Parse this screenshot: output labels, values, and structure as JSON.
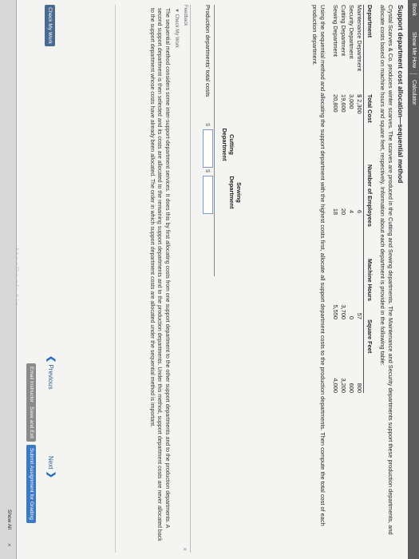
{
  "toolbar": {
    "book": "Book",
    "show_me_how": "Show Me How",
    "calculator": "Calculator"
  },
  "problem": {
    "title": "Support department cost allocation—sequential method",
    "intro": "Crystal Scarves & Co. produces winter scarves. The scarves are produced in the Cutting and Sewing departments. The Maintenance and Security departments support these production departments, and allocate costs based on machine hours and square feet, respectively. Information about each department is provided in the following table:",
    "instruction": "Using the sequential method and allocating the support department with the highest costs first, allocate all support department costs to the production departments. Then compute the total cost of each production department."
  },
  "table": {
    "headers": [
      "Department",
      "Total Cost",
      "Number of Employees",
      "Machine Hours",
      "Square Feet"
    ],
    "rows": [
      [
        "Maintenance Department",
        "$ 2,300",
        "6",
        "57",
        "800"
      ],
      [
        "Security Department",
        "3,000",
        "4",
        "0",
        "600"
      ],
      [
        "Cutting Department",
        "19,600",
        "20",
        "3,700",
        "3,200"
      ],
      [
        "Sewing Department",
        "20,800",
        "18",
        "5,550",
        "4,000"
      ]
    ]
  },
  "answer": {
    "cutting_header_1": "Cutting",
    "cutting_header_2": "Department",
    "sewing_header_1": "Sewing",
    "sewing_header_2": "Department",
    "row_label": "Production departments' total costs",
    "currency": "$",
    "cutting_value": "",
    "sewing_value": ""
  },
  "feedback": {
    "label": "Feedback",
    "check_my_work": "▼ Check My Work",
    "text": "The sequential method considers some inter-support-department services. It does this by first allocating costs from one support department to the other support departments and to the production departments. A second support department is then selected and its costs are allocated to the remaining support departments and to the production departments. Under this method, support department costs are never allocated back to the support department whose costs have already been allocated. The order in which support department costs are allocated under the sequential method is important.",
    "close": "×"
  },
  "buttons": {
    "check_my_work": "Check My Work",
    "previous": "Previous",
    "next": "Next",
    "email_instructor": "Email Instructor",
    "save_and_exit": "Save and Exit",
    "submit": "Submit Assignment for Grading"
  },
  "bottom_bar": {
    "show_all": "Show All",
    "close": "×"
  },
  "watermark": "MacBook Air"
}
